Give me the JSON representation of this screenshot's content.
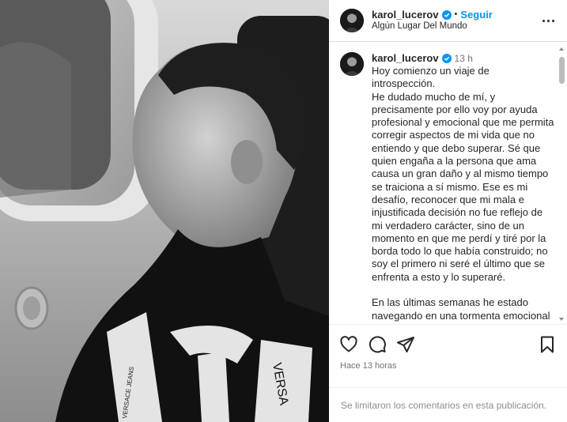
{
  "post": {
    "username": "karol_lucerov",
    "follow_label": "Seguir",
    "separator": "•",
    "location": "Algún Lugar Del Mundo",
    "caption_time": "13 h",
    "caption": "Hoy comienzo un viaje de introspección.\nHe dudado mucho de mí, y precisamente por ello voy por ayuda profesional y emocional que me permita corregir aspectos de mi vida que no entiendo y que debo superar. Sé que quien engaña a la persona que ama causa un gran daño y al mismo tiempo se traiciona a sí mismo. Ese es mi desafío, reconocer que mi mala e injustificada decisión no fue reflejo de mi verdadero carácter, sino de un momento en que me perdí y tiré por la borda todo lo que había construido; no soy el primero ni seré el último que se enfrenta a esto y lo superaré.\n\nEn las últimas semanas he estado navegando en una tormenta emocional difícil de describir",
    "time_ago": "Hace 13 horas",
    "comments_disabled": "Se limitaron los comentarios en esta publicación.",
    "shirt_text_1": "VERSACE JEANS",
    "shirt_text_2": "VERSA"
  },
  "colors": {
    "accent": "#0095f6",
    "verified": "#0095f6",
    "muted": "#737373"
  },
  "icons": {
    "like": "heart-icon",
    "comment": "comment-icon",
    "share": "paper-plane-icon",
    "save": "bookmark-icon",
    "more": "more-options-icon"
  }
}
